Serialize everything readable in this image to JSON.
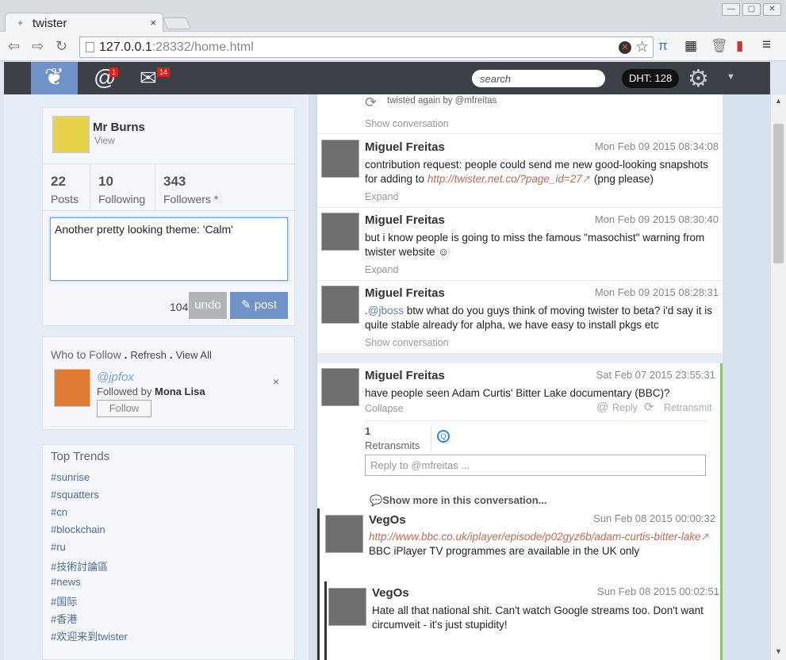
{
  "browser": {
    "tab_title": "twister",
    "tab_close": "×",
    "url_host": "127.0.0.1",
    "url_rest": ":28332/home.html",
    "win_buttons": [
      "—",
      "▢",
      "✕"
    ]
  },
  "appbar": {
    "mentions_badge": "1",
    "messages_badge": "14",
    "search_placeholder": "search",
    "dht": "DHT: 128"
  },
  "profile": {
    "name": "Mr Burns",
    "view": "View",
    "posts_count": "22",
    "posts_label": "Posts",
    "following_count": "10",
    "following_label": "Following",
    "followers_count": "343",
    "followers_label": "Followers *",
    "compose_text": "Another pretty looking theme: 'Calm'",
    "char_count": "104",
    "undo": "undo",
    "post": "post"
  },
  "who_to_follow": {
    "title": "Who to Follow",
    "refresh": "Refresh",
    "view_all": "View All",
    "handle": "@jpfox",
    "followed_by": "Followed by",
    "followed_by_name": "Mona Lisa",
    "follow_button": "Follow",
    "dismiss": "×"
  },
  "trends": {
    "title": "Top Trends",
    "items": [
      "#sunrise",
      "#squatters",
      "#cn",
      "#blockchain",
      "#ru",
      "#技術討論區",
      "#news",
      "#国际",
      "#香港",
      "#欢迎来到twister"
    ]
  },
  "feed": {
    "retwist_text": "twisted again by @mfreitas",
    "show_conversation": "Show conversation",
    "posts": [
      {
        "author": "Miguel Freitas",
        "date": "Mon Feb 09 2015 08:34:08",
        "text_pre": "contribution request: people could send me new good-looking snapshots for adding to ",
        "link": "http://twister.net.co/?page_id=27",
        "text_post": " (png please)",
        "action": "Expand"
      },
      {
        "author": "Miguel Freitas",
        "date": "Mon Feb 09 2015 08:30:40",
        "text": "but i know people is going to miss the famous \"masochist\" warning from twister website ☺",
        "action": "Expand"
      },
      {
        "author": "Miguel Freitas",
        "date": "Mon Feb 09 2015 08:28:31",
        "text_pre": ".",
        "mention": "@jboss",
        "text_post": " btw what do you guys think of moving twister to beta? i'd say it is quite stable already for alpha, we have easy to install pkgs etc",
        "action": "Show conversation"
      },
      {
        "author": "Miguel Freitas",
        "date": "Sat Feb 07 2015 23:55:31",
        "text": "have people seen Adam Curtis' Bitter Lake documentary (BBC)?",
        "action": "Collapse",
        "reply": "Reply",
        "retransmit": "Retransmit",
        "retransmits_count": "1",
        "retransmits_label": "Retransmits",
        "reply_placeholder": "Reply to @mfreitas ...",
        "show_more": "Show more in this conversation..."
      },
      {
        "author": "VegOs",
        "date": "Sun Feb 08 2015 00:00:32",
        "link": "http://www.bbc.co.uk/iplayer/episode/p02gyz6b/adam-curtis-bitter-lake",
        "text": "BBC iPlayer TV programmes are available in the UK only"
      },
      {
        "author": "VegOs",
        "date": "Sun Feb 08 2015 00:02:51",
        "text": "Hate all that national shit. Can't watch Google streams too. Don't want circumveit - it's just stupidity!"
      }
    ]
  }
}
